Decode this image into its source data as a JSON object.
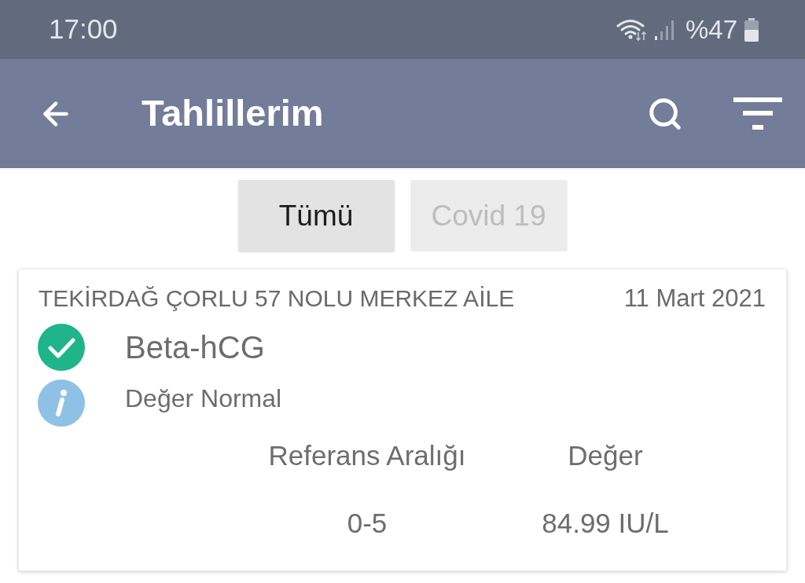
{
  "status_bar": {
    "time": "17:00",
    "battery": "%47"
  },
  "app_bar": {
    "title": "Tahlillerim"
  },
  "tabs": [
    {
      "label": "Tümü",
      "selected": true
    },
    {
      "label": "Covid 19",
      "selected": false
    }
  ],
  "results": [
    {
      "facility": "TEKİRDAĞ ÇORLU 57 NOLU MERKEZ AİLE",
      "date": "11 Mart 2021",
      "test_name": "Beta-hCG",
      "kind": "normal",
      "status": "Değer Normal",
      "columns": [
        "Referans Aralığı",
        "Değer"
      ],
      "values": [
        "0-5",
        "84.99 IU/L"
      ]
    }
  ]
}
